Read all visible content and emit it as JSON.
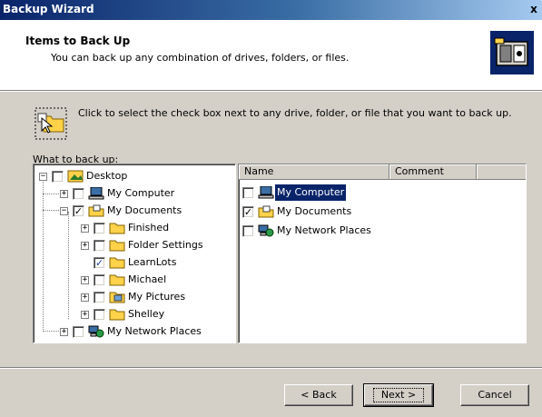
{
  "window": {
    "title": "Backup Wizard",
    "close_glyph": "x"
  },
  "header": {
    "title": "Items to Back Up",
    "subtitle": "You can back up any combination of drives, folders, or files.",
    "icon": "backup-cabinet-icon"
  },
  "hint": {
    "text": "Click to select the check box next to any drive, folder, or file that you want to back up.",
    "icon": "folder-cursor-icon"
  },
  "tree": {
    "label": "What to back up:",
    "items": [
      {
        "label": "Desktop",
        "expander": "−",
        "checked": false,
        "icon": "desktop-icon"
      },
      {
        "label": "My Computer",
        "expander": "+",
        "checked": false,
        "icon": "my-computer-icon"
      },
      {
        "label": "My Documents",
        "expander": "−",
        "checked": true,
        "icon": "my-documents-icon"
      },
      {
        "label": "Finished",
        "expander": "+",
        "checked": false,
        "icon": "folder-icon"
      },
      {
        "label": "Folder Settings",
        "expander": "+",
        "checked": false,
        "icon": "folder-icon"
      },
      {
        "label": "LearnLots",
        "expander": "",
        "checked": true,
        "icon": "folder-icon"
      },
      {
        "label": "Michael",
        "expander": "+",
        "checked": false,
        "icon": "folder-icon"
      },
      {
        "label": "My Pictures",
        "expander": "+",
        "checked": false,
        "icon": "pictures-folder-icon"
      },
      {
        "label": "Shelley",
        "expander": "+",
        "checked": false,
        "icon": "folder-icon"
      },
      {
        "label": "My Network Places",
        "expander": "+",
        "checked": false,
        "icon": "network-places-icon"
      }
    ]
  },
  "list": {
    "columns": [
      "Name",
      "Comment"
    ],
    "rows": [
      {
        "name": "My Computer",
        "checked": false,
        "selected": true,
        "icon": "my-computer-icon"
      },
      {
        "name": "My Documents",
        "checked": true,
        "selected": false,
        "icon": "my-documents-icon"
      },
      {
        "name": "My Network Places",
        "checked": false,
        "selected": false,
        "icon": "network-places-icon"
      }
    ]
  },
  "buttons": {
    "back": "< Back",
    "next": "Next >",
    "cancel": "Cancel"
  },
  "colors": {
    "title_start": "#0a246a",
    "title_end": "#a6caf0",
    "selection": "#0a246a",
    "face": "#d4d0c8"
  }
}
